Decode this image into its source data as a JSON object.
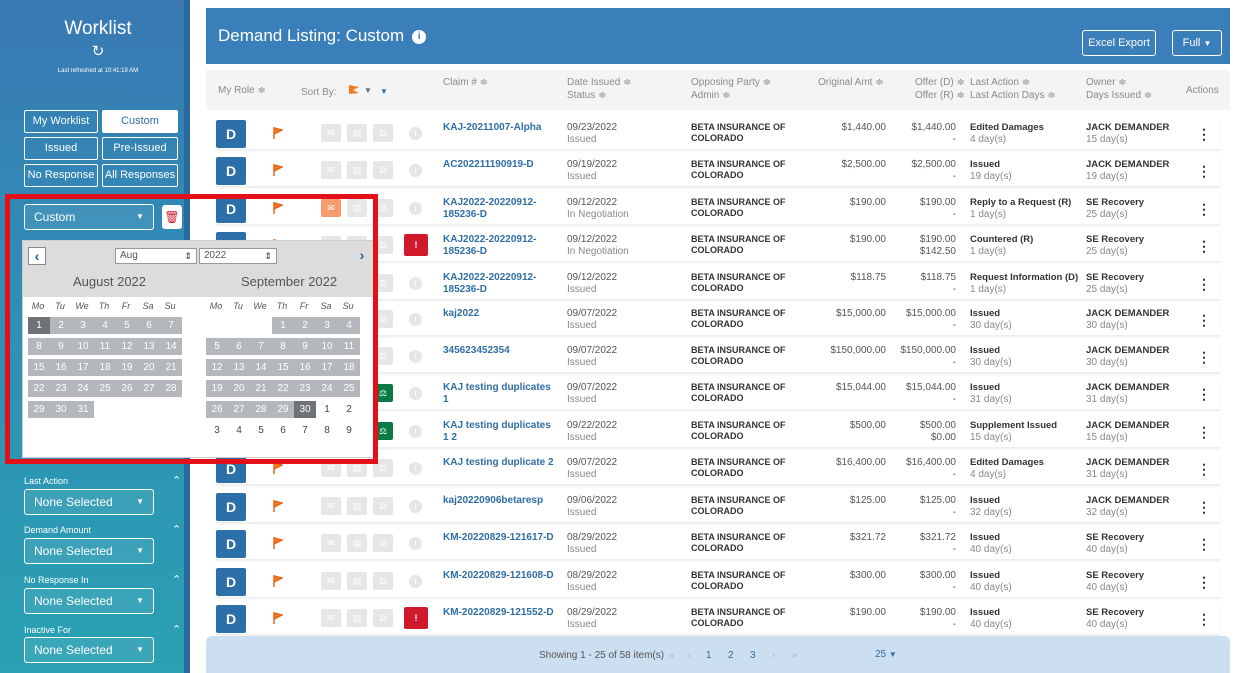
{
  "sidebar": {
    "title": "Worklist",
    "last_refreshed": "Last refreshed at 10:41:19 AM",
    "filter_buttons": [
      "My Worklist",
      "Custom",
      "Issued",
      "Pre-Issued",
      "No Response",
      "All Responses"
    ],
    "active_filter": "Custom",
    "date_select": {
      "value": "Custom"
    },
    "filters": [
      {
        "label": "Last Action",
        "value": "None Selected"
      },
      {
        "label": "Demand Amount",
        "value": "None Selected"
      },
      {
        "label": "No Response In",
        "value": "None Selected"
      },
      {
        "label": "Inactive For",
        "value": "None Selected"
      }
    ]
  },
  "calendar": {
    "month_select": "Aug",
    "year_select": "2022",
    "months": [
      {
        "name": "August 2022"
      },
      {
        "name": "September 2022"
      }
    ],
    "dow": [
      "Mo",
      "Tu",
      "We",
      "Th",
      "Fr",
      "Sa",
      "Su"
    ],
    "aug_days": [
      "1",
      "2",
      "3",
      "4",
      "5",
      "6",
      "7",
      "8",
      "9",
      "10",
      "11",
      "12",
      "13",
      "14",
      "15",
      "16",
      "17",
      "18",
      "19",
      "20",
      "21",
      "22",
      "23",
      "24",
      "25",
      "26",
      "27",
      "28",
      "29",
      "30",
      "31"
    ],
    "sep_days": [
      "1",
      "2",
      "3",
      "4",
      "5",
      "6",
      "7",
      "8",
      "9",
      "10",
      "11",
      "12",
      "13",
      "14",
      "15",
      "16",
      "17",
      "18",
      "19",
      "20",
      "21",
      "22",
      "23",
      "24",
      "25",
      "26",
      "27",
      "28",
      "29",
      "30"
    ],
    "oct_days": [
      "1",
      "2",
      "3",
      "4",
      "5",
      "6",
      "7",
      "8",
      "9"
    ]
  },
  "header": {
    "title": "Demand Listing: Custom",
    "excel_export": "Excel Export",
    "view": "Full"
  },
  "columns": {
    "my_role": "My Role ≑",
    "sort_by": "Sort By:",
    "claim": "Claim # ≑",
    "date_issued": "Date Issued ≑",
    "status": "Status ≑",
    "opposing_party": "Opposing Party ≑",
    "admin": "Admin ≑",
    "original_amt": "Original Amt ≑",
    "offer_d": "Offer (D) ≑",
    "offer_r": "Offer (R) ≑",
    "last_action": "Last Action ≑",
    "last_action_days": "Last Action Days ≑",
    "owner": "Owner ≑",
    "days_issued": "Days Issued ≑",
    "actions": "Actions"
  },
  "rows": [
    {
      "role": "D",
      "claim": "KAJ-20211007-Alpha",
      "date": "09/23/2022",
      "status": "Issued",
      "party": "BETA INSURANCE OF COLORADO",
      "orig": "$1,440.00",
      "offer_d": "$1,440.00",
      "offer_r": "-",
      "last": "Edited Damages",
      "last_days": "4 day(s)",
      "owner": "JACK DEMANDER",
      "days": "15 day(s)"
    },
    {
      "role": "D",
      "claim": "AC202211190919-D",
      "date": "09/19/2022",
      "status": "Issued",
      "party": "BETA INSURANCE OF COLORADO",
      "orig": "$2,500.00",
      "offer_d": "$2,500.00",
      "offer_r": "-",
      "last": "Issued",
      "last_days": "19 day(s)",
      "owner": "JACK DEMANDER",
      "days": "19 day(s)"
    },
    {
      "role": "D",
      "claim": "KAJ2022-20220912-185236-D",
      "date": "09/12/2022",
      "status": "In Negotiation",
      "party": "BETA INSURANCE OF COLORADO",
      "orig": "$190.00",
      "offer_d": "$190.00",
      "offer_r": "-",
      "last": "Reply to a Request (R)",
      "last_days": "1 day(s)",
      "owner": "SE Recovery",
      "days": "25 day(s)"
    },
    {
      "role": "D",
      "claim": "KAJ2022-20220912-185236-D",
      "date": "09/12/2022",
      "status": "In Negotiation",
      "party": "BETA INSURANCE OF COLORADO",
      "orig": "$190.00",
      "offer_d": "$190.00",
      "offer_r": "$142.50",
      "last": "Countered (R)",
      "last_days": "1 day(s)",
      "owner": "SE Recovery",
      "days": "25 day(s)"
    },
    {
      "role": "D",
      "claim": "KAJ2022-20220912-185236-D",
      "date": "09/12/2022",
      "status": "Issued",
      "party": "BETA INSURANCE OF COLORADO",
      "orig": "$118.75",
      "offer_d": "$118.75",
      "offer_r": "-",
      "last": "Request Information (D)",
      "last_days": "1 day(s)",
      "owner": "SE Recovery",
      "days": "25 day(s)"
    },
    {
      "role": "D",
      "claim": "kaj2022",
      "date": "09/07/2022",
      "status": "Issued",
      "party": "BETA INSURANCE OF COLORADO",
      "orig": "$15,000.00",
      "offer_d": "$15,000.00",
      "offer_r": "-",
      "last": "Issued",
      "last_days": "30 day(s)",
      "owner": "JACK DEMANDER",
      "days": "30 day(s)"
    },
    {
      "role": "D",
      "claim": "345623452354",
      "date": "09/07/2022",
      "status": "Issued",
      "party": "BETA INSURANCE OF COLORADO",
      "orig": "$150,000.00",
      "offer_d": "$150,000.00",
      "offer_r": "-",
      "last": "Issued",
      "last_days": "30 day(s)",
      "owner": "JACK DEMANDER",
      "days": "30 day(s)"
    },
    {
      "role": "D",
      "claim": "KAJ testing duplicates 1",
      "date": "09/07/2022",
      "status": "Issued",
      "party": "BETA INSURANCE OF COLORADO",
      "orig": "$15,044.00",
      "offer_d": "$15,044.00",
      "offer_r": "-",
      "last": "Issued",
      "last_days": "31 day(s)",
      "owner": "JACK DEMANDER",
      "days": "31 day(s)"
    },
    {
      "role": "D",
      "claim": "KAJ testing duplicates 1 2",
      "date": "09/22/2022",
      "status": "Issued",
      "party": "BETA INSURANCE OF COLORADO",
      "orig": "$500.00",
      "offer_d": "$500.00",
      "offer_r": "$0.00",
      "last": "Supplement Issued",
      "last_days": "15 day(s)",
      "owner": "JACK DEMANDER",
      "days": "15 day(s)"
    },
    {
      "role": "D",
      "claim": "KAJ testing duplicate 2",
      "date": "09/07/2022",
      "status": "Issued",
      "party": "BETA INSURANCE OF COLORADO",
      "orig": "$16,400.00",
      "offer_d": "$16,400.00",
      "offer_r": "-",
      "last": "Edited Damages",
      "last_days": "4 day(s)",
      "owner": "JACK DEMANDER",
      "days": "31 day(s)"
    },
    {
      "role": "D",
      "claim": "kaj20220906betaresp",
      "date": "09/06/2022",
      "status": "Issued",
      "party": "BETA INSURANCE OF COLORADO",
      "orig": "$125.00",
      "offer_d": "$125.00",
      "offer_r": "-",
      "last": "Issued",
      "last_days": "32 day(s)",
      "owner": "JACK DEMANDER",
      "days": "32 day(s)"
    },
    {
      "role": "D",
      "claim": "KM-20220829-121617-D",
      "date": "08/29/2022",
      "status": "Issued",
      "party": "BETA INSURANCE OF COLORADO",
      "orig": "$321.72",
      "offer_d": "$321.72",
      "offer_r": "-",
      "last": "Issued",
      "last_days": "40 day(s)",
      "owner": "SE Recovery",
      "days": "40 day(s)"
    },
    {
      "role": "D",
      "claim": "KM-20220829-121608-D",
      "date": "08/29/2022",
      "status": "Issued",
      "party": "BETA INSURANCE OF COLORADO",
      "orig": "$300.00",
      "offer_d": "$300.00",
      "offer_r": "-",
      "last": "Issued",
      "last_days": "40 day(s)",
      "owner": "SE Recovery",
      "days": "40 day(s)"
    },
    {
      "role": "D",
      "claim": "KM-20220829-121552-D",
      "date": "08/29/2022",
      "status": "Issued",
      "party": "BETA INSURANCE OF COLORADO",
      "orig": "$190.00",
      "offer_d": "$190.00",
      "offer_r": "-",
      "last": "Issued",
      "last_days": "40 day(s)",
      "owner": "SE Recovery",
      "days": "40 day(s)"
    }
  ],
  "pager": {
    "showing": "Showing 1 - 25 of 58 item(s)",
    "first": "«",
    "prev": "‹",
    "pages": [
      "1",
      "2",
      "3"
    ],
    "next": "›",
    "last": "»",
    "page_size": "25"
  }
}
